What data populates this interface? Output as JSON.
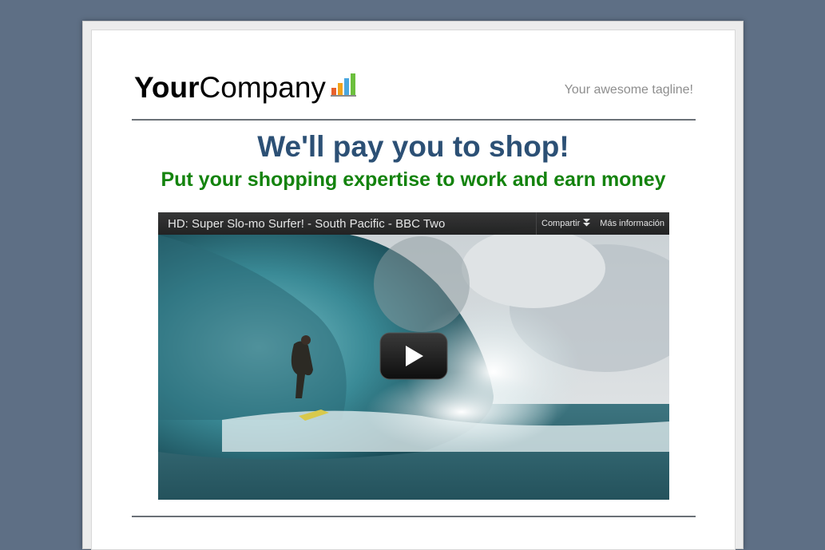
{
  "header": {
    "logo_bold": "Your",
    "logo_regular": "Company",
    "logo_icon": "bar-chart-icon",
    "tagline": "Your awesome tagline!"
  },
  "hero": {
    "headline": "We'll pay you to shop!",
    "subheadline": "Put your shopping expertise to work and earn money"
  },
  "video": {
    "title": "HD: Super Slo-mo Surfer! - South Pacific - BBC Two",
    "share_label": "Compartir",
    "share_icon": "double-chevron-down-icon",
    "more_info_label": "Más información",
    "play_icon": "play-icon"
  },
  "colors": {
    "background": "#5e6f85",
    "headline": "#2c5075",
    "subheadline": "#14830e",
    "tagline": "#8e8e8e",
    "rule": "#6b7177"
  }
}
